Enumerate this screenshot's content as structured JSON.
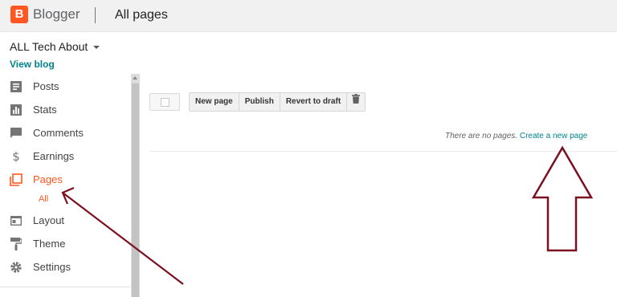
{
  "header": {
    "logo_letter": "B",
    "brand": "Blogger",
    "title": "All pages"
  },
  "blog": {
    "name": "ALL Tech About",
    "view_blog": "View blog"
  },
  "sidebar": {
    "items": [
      {
        "label": "Posts",
        "icon": "posts-icon"
      },
      {
        "label": "Stats",
        "icon": "stats-icon"
      },
      {
        "label": "Comments",
        "icon": "comments-icon"
      },
      {
        "label": "Earnings",
        "icon": "dollar-icon"
      },
      {
        "label": "Pages",
        "icon": "pages-icon",
        "active": true
      },
      {
        "label": "Layout",
        "icon": "layout-icon"
      },
      {
        "label": "Theme",
        "icon": "theme-icon"
      },
      {
        "label": "Settings",
        "icon": "gear-icon"
      }
    ],
    "sub_item": "All"
  },
  "toolbar": {
    "new_page": "New page",
    "publish": "Publish",
    "revert": "Revert to draft",
    "delete_icon": "trash-icon"
  },
  "main": {
    "empty_text": "There are no pages.",
    "create_link": "Create a new page"
  },
  "colors": {
    "brand": "#ff5722",
    "link": "#00838f",
    "annotation": "#7b1020"
  }
}
